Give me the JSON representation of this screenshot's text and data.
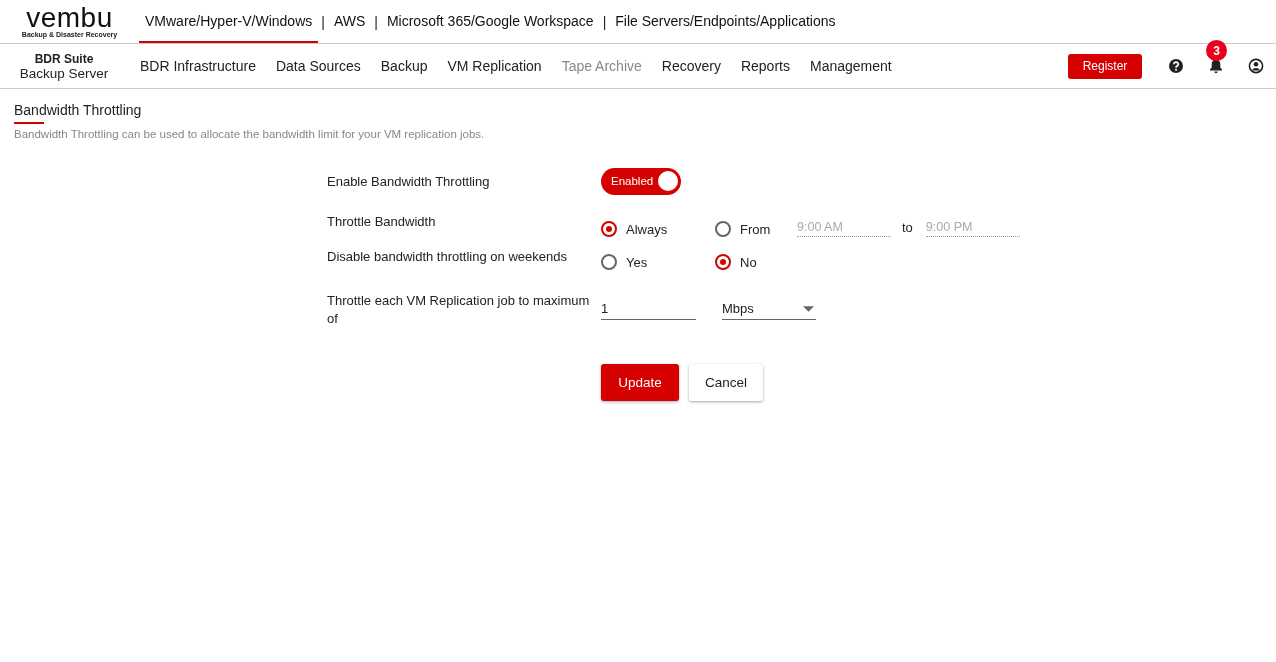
{
  "logo": {
    "name": "vembu",
    "tagline": "Backup & Disaster Recovery"
  },
  "product_tabs": [
    {
      "label": "VMware/Hyper-V/Windows",
      "selected": true
    },
    {
      "separator": "|",
      "label": "AWS",
      "selected": false
    },
    {
      "separator": "|",
      "label": "Microsoft 365/Google Workspace",
      "selected": false
    },
    {
      "separator": "|",
      "label": "File Servers/Endpoints/Applications",
      "selected": false
    }
  ],
  "server": {
    "suite": "BDR Suite",
    "name": "Backup Server"
  },
  "nav": [
    {
      "label": "BDR Infrastructure",
      "disabled": false
    },
    {
      "label": "Data Sources",
      "disabled": false
    },
    {
      "label": "Backup",
      "disabled": false
    },
    {
      "label": "VM Replication",
      "disabled": false
    },
    {
      "label": "Tape Archive",
      "disabled": true
    },
    {
      "label": "Recovery",
      "disabled": false
    },
    {
      "label": "Reports",
      "disabled": false
    },
    {
      "label": "Management",
      "disabled": false
    }
  ],
  "register_button": "Register",
  "notification_count": "3",
  "page": {
    "title": "Bandwidth Throttling",
    "description": "Bandwidth Throttling can be used to allocate the bandwidth limit for your VM replication jobs."
  },
  "form": {
    "enable": {
      "label": "Enable Bandwidth Throttling",
      "on": true,
      "state_label": "Enabled"
    },
    "throttle": {
      "label": "Throttle Bandwidth",
      "options": [
        {
          "label": "Always",
          "selected": true
        },
        {
          "label": "From",
          "selected": false
        }
      ],
      "from": {
        "placeholder": "9:00 AM",
        "disabled": true
      },
      "to_label": "to",
      "to": {
        "placeholder": "9:00 PM",
        "disabled": true
      }
    },
    "weekends": {
      "label": "Disable bandwidth throttling on weekends",
      "options": [
        {
          "label": "Yes",
          "selected": false
        },
        {
          "label": "No",
          "selected": true
        }
      ]
    },
    "limit": {
      "label": "Throttle each VM Replication job to maximum of",
      "value": "1",
      "unit": "Mbps"
    },
    "buttons": [
      {
        "label": "Update",
        "kind": "primary"
      },
      {
        "label": "Cancel",
        "kind": "secondary"
      }
    ]
  }
}
